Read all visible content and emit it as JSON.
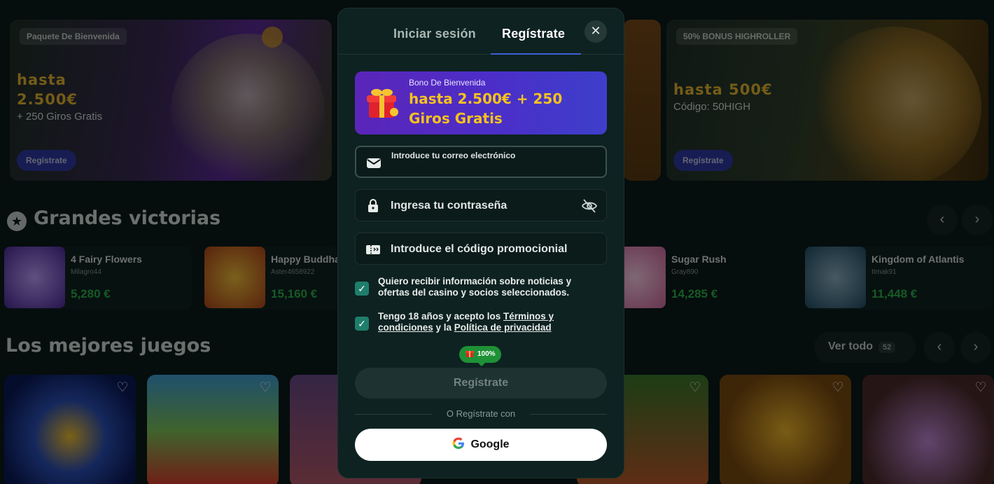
{
  "background": {
    "banner_left": {
      "tag": "Paquete De Bienvenida",
      "line1": "hasta",
      "line2": "2.500€",
      "sub": "+ 250 Giros Gratis",
      "button": "Regístrate"
    },
    "banner_right": {
      "tag": "50% BONUS HIGHROLLER",
      "line1": "hasta 500€",
      "sub": "Código: 50HIGH",
      "button": "Regístrate"
    },
    "big_wins": {
      "title": "Grandes victorias",
      "items": [
        {
          "game": "4 Fairy Flowers",
          "user": "Milagro44",
          "amount": "5,280 €",
          "color": "#6a3ab0"
        },
        {
          "game": "Happy Buddha",
          "user": "Aster4658922",
          "amount": "15,160 €",
          "color": "#c8751a"
        },
        {
          "game": "Sugar Rush",
          "user": "Gray890",
          "amount": "14,285 €",
          "color": "#e08ab8"
        },
        {
          "game": "Kingdom of Atlantis",
          "user": "Itmak91",
          "amount": "11,448 €",
          "color": "#2b6f8c"
        }
      ]
    },
    "top_games": {
      "title": "Los mejores juegos",
      "see_all": "Ver todo",
      "count": "52"
    }
  },
  "modal": {
    "tabs": [
      {
        "label": "Iniciar sesión",
        "active": false
      },
      {
        "label": "Regístrate",
        "active": true
      }
    ],
    "close_icon": "close-icon",
    "bonus": {
      "small": "Bono De Bienvenida",
      "amount": "hasta 2.500€ + 250 Giros Gratis"
    },
    "email": {
      "label": "Introduce tu correo electrónico",
      "value": ""
    },
    "password": {
      "label": "Ingresa tu contraseña"
    },
    "promo": {
      "label": "Introduce el código promocionial"
    },
    "newsletter": {
      "checked": true,
      "text": "Quiero recibir información sobre noticias y ofertas del casino y socios seleccionados."
    },
    "terms": {
      "checked": true,
      "text_before": "Tengo 18 años y acepto los ",
      "terms_link": "Términos y condiciones",
      "text_mid": " y la ",
      "privacy_link": "Política de privacidad"
    },
    "progress": "100%",
    "submit": "Regístrate",
    "or_register_with": "O Regístrate con",
    "google": "Google"
  },
  "colors": {
    "accent": "#3b5fd8",
    "win_amount": "#2fb24a",
    "bonus_gold": "#f5c21e",
    "checkbox": "#1f7d6b"
  }
}
